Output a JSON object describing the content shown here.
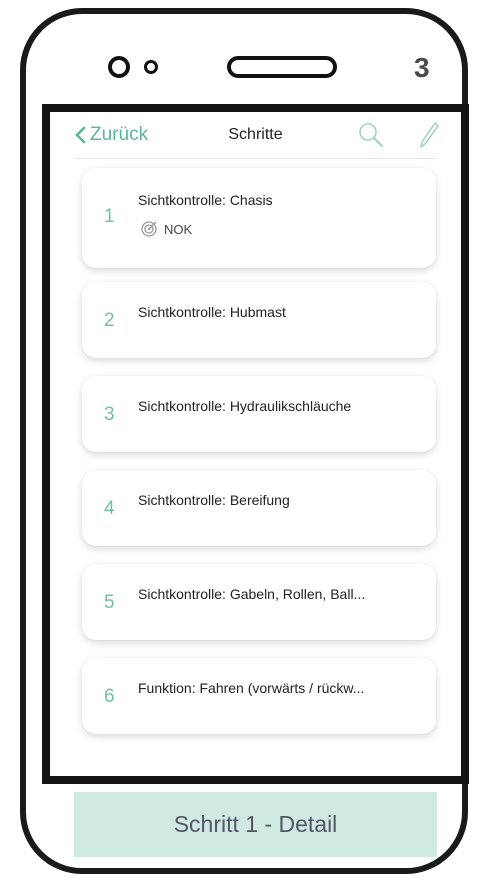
{
  "page_number": "3",
  "nav": {
    "back_label": "Zurück",
    "title": "Schritte"
  },
  "steps": [
    {
      "number": "1",
      "title": "Sichtkontrolle: Chasis",
      "status": "NOK"
    },
    {
      "number": "2",
      "title": "Sichtkontrolle: Hubmast"
    },
    {
      "number": "3",
      "title": "Sichtkontrolle: Hydraulikschläuche"
    },
    {
      "number": "4",
      "title": "Sichtkontrolle: Bereifung"
    },
    {
      "number": "5",
      "title": "Sichtkontrolle: Gabeln, Rollen, Ball..."
    },
    {
      "number": "6",
      "title": "Funktion: Fahren (vorwärts / rückw..."
    }
  ],
  "detail_label": "Schritt 1 - Detail",
  "colors": {
    "accent": "#5cb59d",
    "step_number": "#74bfa8",
    "detail_bg": "#cfeae2"
  }
}
